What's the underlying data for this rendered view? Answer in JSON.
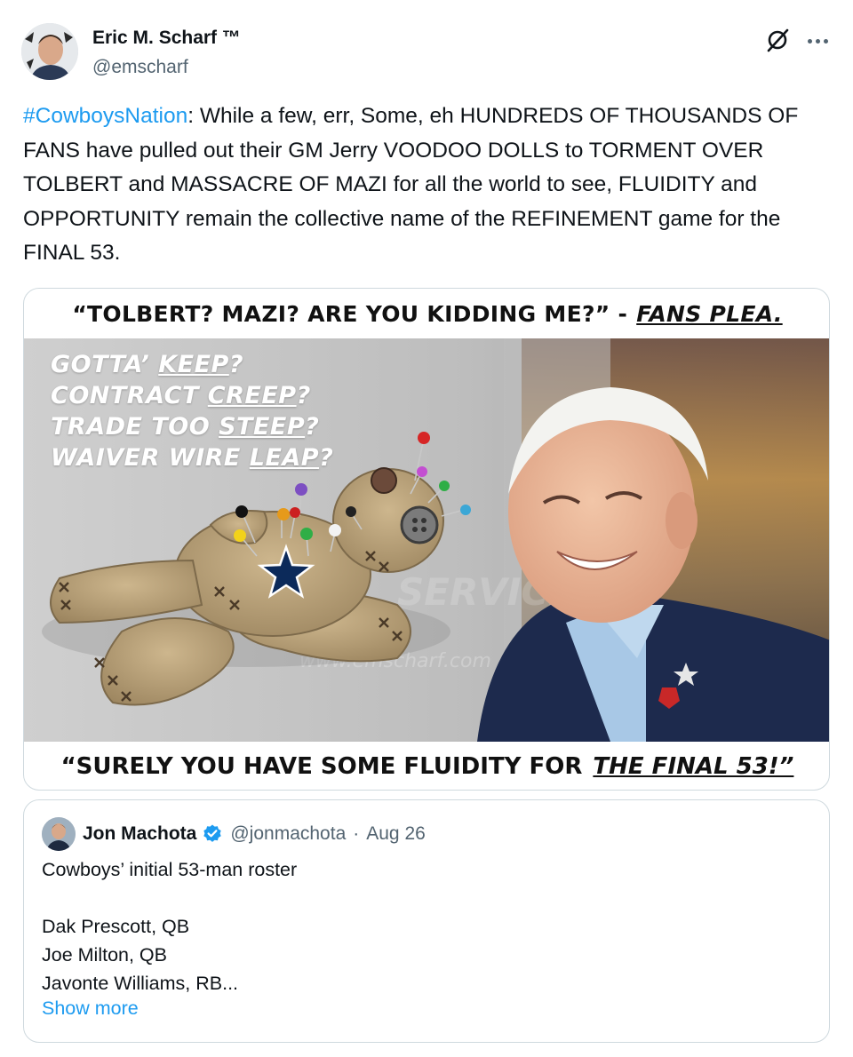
{
  "author": {
    "display_name": "Eric M. Scharf ™",
    "handle": "@emscharf"
  },
  "icons": {
    "grok": "grok-icon",
    "more": "more-icon",
    "verified": "verified-badge-icon"
  },
  "tweet": {
    "hashtag": "#CowboysNation",
    "text": ": While a few, err, Some, eh HUNDREDS OF THOUSANDS OF FANS have pulled out their GM Jerry VOODOO DOLLS to TORMENT OVER TOLBERT and MASSACRE OF MAZI for all the world to see, FLUIDITY and OPPORTUNITY remain the collective name of the REFINEMENT game for the FINAL 53."
  },
  "media": {
    "top_caption": "“TOLBERT? MAZI? ARE YOU KIDDING ME?” -",
    "top_caption_emphasis": "FANS PLEA.",
    "taglines": [
      {
        "pre": "GOTTA’ ",
        "em": "KEEP",
        "post": "?"
      },
      {
        "pre": "CONTRACT ",
        "em": "CREEP",
        "post": "?"
      },
      {
        "pre": "TRADE TOO ",
        "em": "STEEP",
        "post": "?"
      },
      {
        "pre": "WAIVER WIRE ",
        "em": "LEAP",
        "post": "?"
      }
    ],
    "bottom_caption": "“SURELY YOU HAVE SOME FLUIDITY FOR",
    "bottom_caption_emphasis": "THE FINAL 53!”"
  },
  "quote": {
    "name": "Jon Machota",
    "handle": "@jonmachota",
    "separator": "·",
    "date": "Aug 26",
    "lines": [
      "Cowboys’ initial 53-man roster",
      "",
      "Dak Prescott, QB",
      "Joe Milton, QB",
      "Javonte Williams, RB..."
    ],
    "show_more": "Show more"
  },
  "colors": {
    "link": "#1d9bf0",
    "secondary_text": "#536471",
    "border": "#cfd9de",
    "verified": "#1d9bf0"
  }
}
